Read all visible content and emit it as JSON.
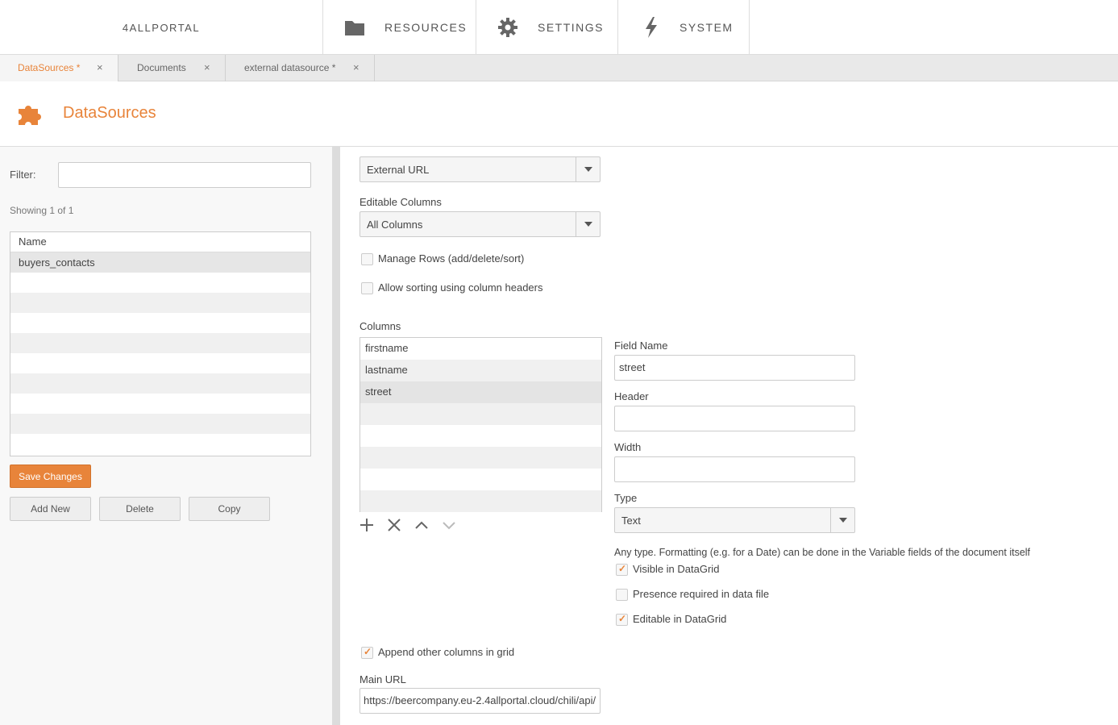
{
  "nav": {
    "brand": "4ALLPORTAL",
    "items": [
      {
        "label": "RESOURCES",
        "icon": "folder-icon"
      },
      {
        "label": "SETTINGS",
        "icon": "gear-icon"
      },
      {
        "label": "SYSTEM",
        "icon": "lightning-icon"
      }
    ]
  },
  "tabs": [
    {
      "label": "DataSources *",
      "close": "×",
      "active": true
    },
    {
      "label": "Documents",
      "close": "×",
      "active": false
    },
    {
      "label": "external datasource *",
      "close": "×",
      "active": false
    }
  ],
  "page": {
    "title": "DataSources",
    "icon": "puzzle-icon",
    "accent": "#e8843a"
  },
  "left": {
    "filter_label": "Filter:",
    "filter_value": "",
    "showing": "Showing 1 of 1",
    "grid_header": "Name",
    "rows": [
      "buyers_contacts"
    ],
    "buttons": {
      "save": "Save Changes",
      "add": "Add New",
      "delete": "Delete",
      "copy": "Copy"
    }
  },
  "right": {
    "source_type": "External URL",
    "editable_columns_label": "Editable Columns",
    "editable_columns_value": "All Columns",
    "manage_rows_label": "Manage Rows (add/delete/sort)",
    "manage_rows_checked": false,
    "allow_sorting_label": "Allow sorting using column headers",
    "allow_sorting_checked": false,
    "columns_label": "Columns",
    "columns": [
      "firstname",
      "lastname",
      "street"
    ],
    "selected_column": "street",
    "field_name_label": "Field Name",
    "field_name_value": "street",
    "header_label": "Header",
    "header_value": "",
    "width_label": "Width",
    "width_value": "",
    "type_label": "Type",
    "type_value": "Text",
    "type_hint": "Any type. Formatting (e.g. for a Date) can be done in the Variable fields of the document itself",
    "visible_label": "Visible in DataGrid",
    "visible_checked": true,
    "presence_label": "Presence required in data file",
    "presence_checked": false,
    "editable_label": "Editable in DataGrid",
    "editable_checked": true,
    "append_label": "Append other columns in grid",
    "append_checked": true,
    "main_url_label": "Main URL",
    "main_url_value": "https://beercompany.eu-2.4allportal.cloud/chili/api/"
  }
}
